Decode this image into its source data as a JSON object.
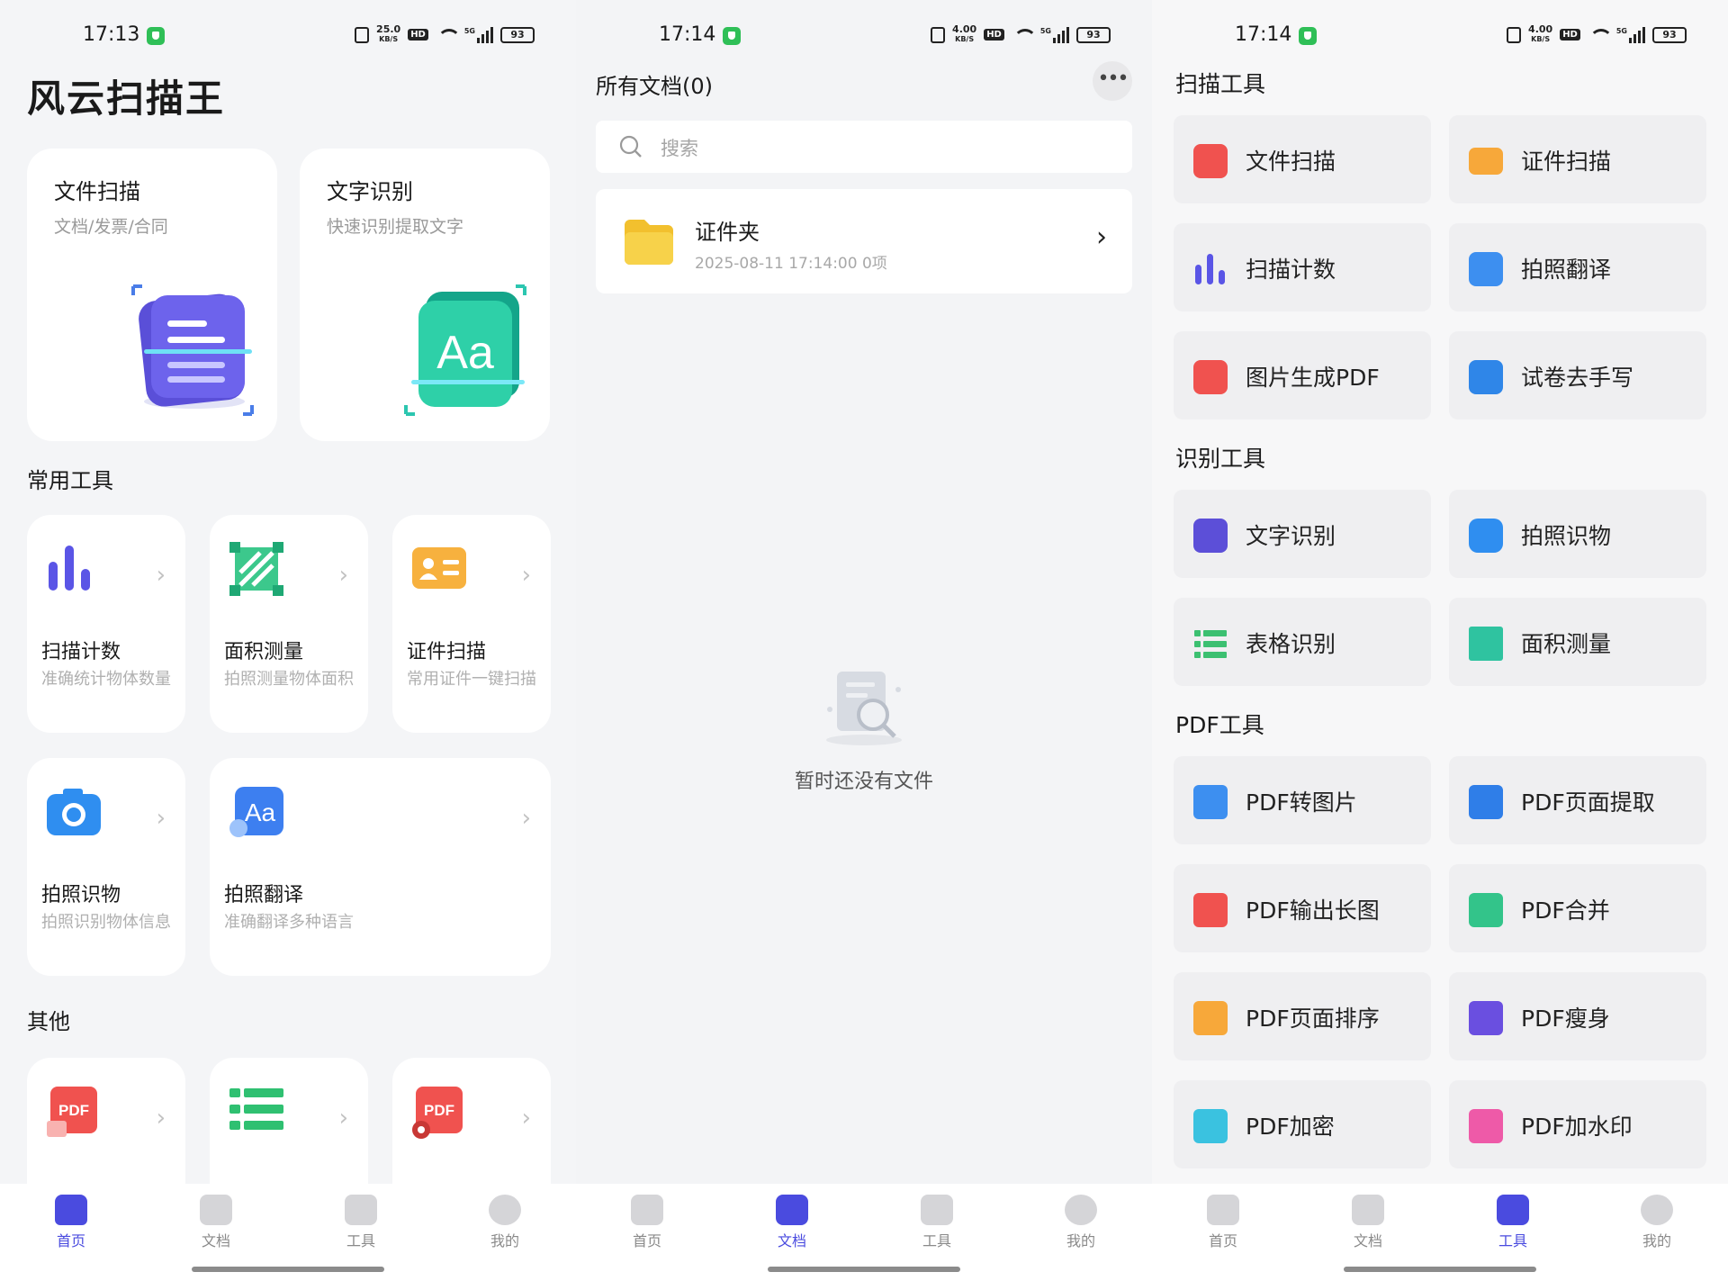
{
  "status_bars": [
    {
      "time": "17:13",
      "speed_top": "25.0",
      "speed_unit": "KB/S",
      "hd": "HD",
      "net": "5G",
      "battery": "93"
    },
    {
      "time": "17:14",
      "speed_top": "4.00",
      "speed_unit": "KB/S",
      "hd": "HD",
      "net": "5G",
      "battery": "93"
    },
    {
      "time": "17:14",
      "speed_top": "4.00",
      "speed_unit": "KB/S",
      "hd": "HD",
      "net": "5G",
      "battery": "93"
    }
  ],
  "home": {
    "app_title": "风云扫描王",
    "hero_cards": [
      {
        "title": "文件扫描",
        "subtitle": "文档/发票/合同"
      },
      {
        "title": "文字识别",
        "subtitle": "快速识别提取文字",
        "art_text": "Aa"
      }
    ],
    "common_tools_title": "常用工具",
    "common_tools": [
      {
        "title": "扫描计数",
        "desc": "准确统计物体数量",
        "icon": "bar-chart-icon"
      },
      {
        "title": "面积测量",
        "desc": "拍照测量物体面积",
        "icon": "area-measure-icon"
      },
      {
        "title": "证件扫描",
        "desc": "常用证件一键扫描",
        "icon": "id-card-icon"
      },
      {
        "title": "拍照识物",
        "desc": "拍照识别物体信息",
        "icon": "camera-icon"
      },
      {
        "title": "拍照翻译",
        "desc": "准确翻译多种语言",
        "icon": "translate-icon",
        "icon_text": "Aa"
      }
    ],
    "other_title": "其他",
    "other_tools": [
      {
        "icon": "pdf-image-icon",
        "icon_text": "PDF"
      },
      {
        "icon": "table-icon"
      },
      {
        "icon": "pdf-tool-icon",
        "icon_text": "PDF"
      }
    ]
  },
  "docs": {
    "title": "所有文档(0)",
    "search_placeholder": "搜索",
    "folder": {
      "name": "证件夹",
      "meta": "2025-08-11  17:14:00  0项"
    },
    "empty_text": "暂时还没有文件"
  },
  "tools": {
    "sections": [
      {
        "title": "扫描工具",
        "items": [
          {
            "label": "文件扫描",
            "icon": "doc-scan-icon",
            "color": "#f0524f"
          },
          {
            "label": "证件扫描",
            "icon": "id-card-icon",
            "color": "#f7a83a"
          },
          {
            "label": "扫描计数",
            "icon": "bar-chart-icon",
            "color": "#5a55e6"
          },
          {
            "label": "拍照翻译",
            "icon": "translate-icon",
            "color": "#3d8ff0"
          },
          {
            "label": "图片生成PDF",
            "icon": "pdf-image-icon",
            "color": "#f0524f"
          },
          {
            "label": "试卷去手写",
            "icon": "exam-icon",
            "color": "#2f86e8"
          }
        ]
      },
      {
        "title": "识别工具",
        "items": [
          {
            "label": "文字识别",
            "icon": "text-recognize-icon",
            "color": "#5c4fd8"
          },
          {
            "label": "拍照识物",
            "icon": "camera-icon",
            "color": "#2f8ef0"
          },
          {
            "label": "表格识别",
            "icon": "table-icon",
            "color": "#3cc071"
          },
          {
            "label": "面积测量",
            "icon": "area-measure-icon",
            "color": "#2fc3a0"
          }
        ]
      },
      {
        "title": "PDF工具",
        "items": [
          {
            "label": "PDF转图片",
            "icon": "pdf-to-image-icon",
            "color": "#3d8ff0"
          },
          {
            "label": "PDF页面提取",
            "icon": "pdf-extract-icon",
            "color": "#2f7ee8"
          },
          {
            "label": "PDF输出长图",
            "icon": "pdf-long-image-icon",
            "color": "#f0524f"
          },
          {
            "label": "PDF合并",
            "icon": "pdf-merge-icon",
            "color": "#33c48a"
          },
          {
            "label": "PDF页面排序",
            "icon": "pdf-sort-icon",
            "color": "#f7a83a"
          },
          {
            "label": "PDF瘦身",
            "icon": "pdf-compress-icon",
            "color": "#6a4fe0"
          },
          {
            "label": "PDF加密",
            "icon": "pdf-encrypt-icon",
            "color": "#3ac2e0"
          },
          {
            "label": "PDF加水印",
            "icon": "pdf-watermark-icon",
            "color": "#ee5aa8"
          }
        ]
      }
    ]
  },
  "nav": {
    "items": [
      {
        "label": "首页",
        "icon": "home-icon"
      },
      {
        "label": "文档",
        "icon": "folder-icon"
      },
      {
        "label": "工具",
        "icon": "tools-icon"
      },
      {
        "label": "我的",
        "icon": "profile-icon"
      }
    ],
    "active_color": "#4a4bdf",
    "inactive_color": "#c9c9cc"
  }
}
